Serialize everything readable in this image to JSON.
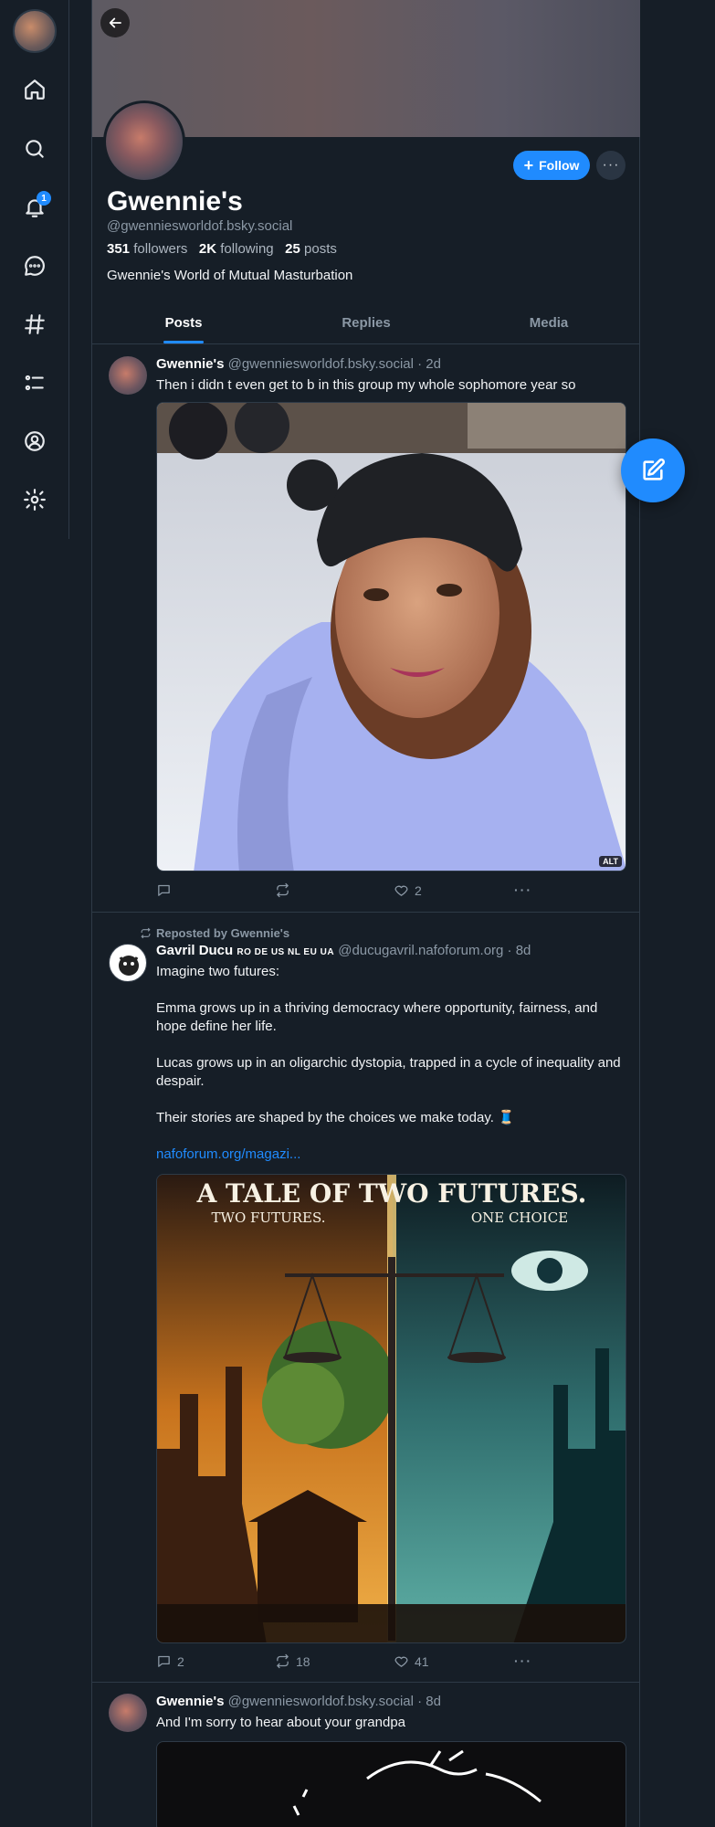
{
  "sidebar": {
    "notification_count": "1",
    "icons": [
      "home-icon",
      "search-icon",
      "bell-icon",
      "chat-icon",
      "hashtag-icon",
      "list-icon",
      "profile-icon",
      "settings-icon"
    ]
  },
  "profile": {
    "display_name": "Gwennie's",
    "handle": "@gwenniesworldof.bsky.social",
    "followers_count": "351",
    "followers_label": "followers",
    "following_count": "2K",
    "following_label": "following",
    "posts_count": "25",
    "posts_label": "posts",
    "bio": "Gwennie's World of Mutual Masturbation",
    "follow_label": "Follow",
    "more_label": "···"
  },
  "tabs": [
    {
      "label": "Posts",
      "active": true
    },
    {
      "label": "Replies",
      "active": false
    },
    {
      "label": "Media",
      "active": false
    }
  ],
  "posts": [
    {
      "author": "Gwennie's",
      "handle": "@gwenniesworldof.bsky.social",
      "time": "· 2d",
      "text": "Then i didn t even get to b in this group my whole sophomore year so",
      "alt_badge": "ALT",
      "reply_count": "",
      "repost_count": "",
      "like_count": "2"
    },
    {
      "repost_label": "Reposted by Gwennie's",
      "author": "Gavril Ducu",
      "flags": "RO DE US NL EU UA",
      "handle": "@ducugavril.nafoforum.org",
      "time": "· 8d",
      "line1": "Imagine two futures:",
      "line2": "Emma grows up in a thriving democracy where opportunity, fairness, and hope define her life.",
      "line3": "Lucas grows up in an oligarchic dystopia, trapped in a cycle of inequality and despair.",
      "line4": "Their stories are shaped by the choices we make today. 🧵",
      "link": "nafoforum.org/magazi...",
      "image_title": "A TALE OF TWO FUTURES.",
      "image_sub_left": "TWO FUTURES.",
      "image_sub_right": "ONE CHOICE",
      "reply_count": "2",
      "repost_count": "18",
      "like_count": "41"
    },
    {
      "author": "Gwennie's",
      "handle": "@gwenniesworldof.bsky.social",
      "time": "· 8d",
      "text": "And I'm sorry to hear about your grandpa"
    }
  ]
}
